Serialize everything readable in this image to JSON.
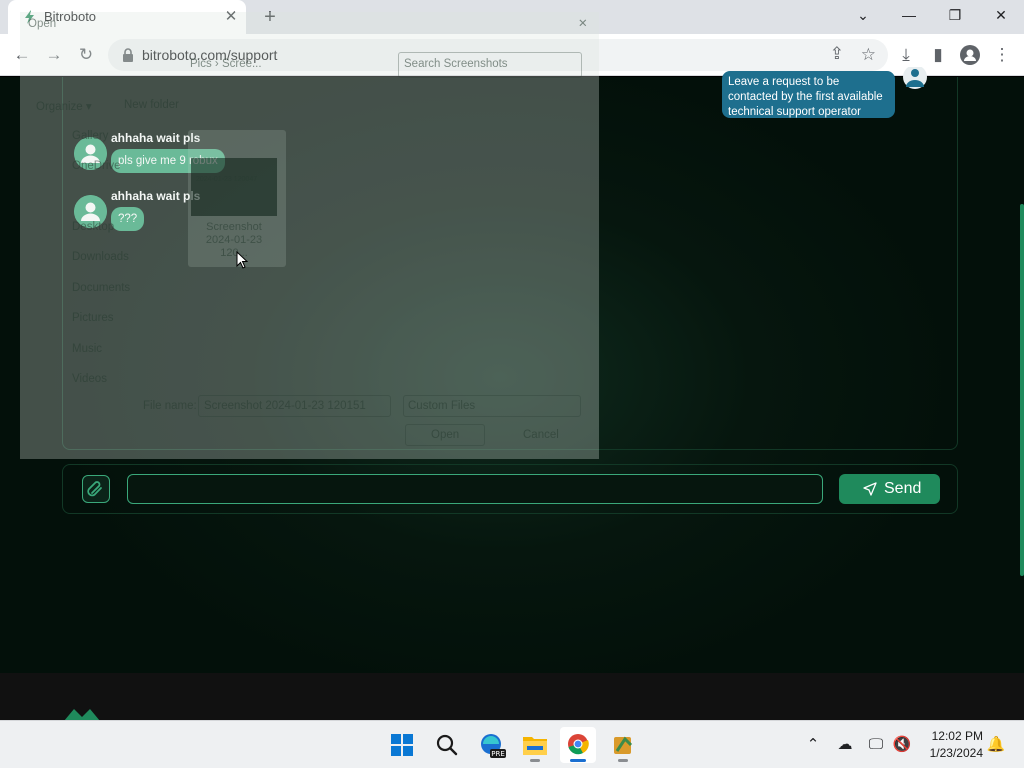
{
  "browser": {
    "tab_title": "Bitroboto",
    "url": "bitroboto.com/support",
    "icons": [
      "favicon-icon",
      "close-icon",
      "plus-icon",
      "back-icon",
      "forward-icon",
      "reload-icon",
      "lock-icon",
      "share-icon",
      "star-icon",
      "download-icon",
      "side-panel-icon",
      "profile-icon",
      "menu-icon"
    ],
    "window_controls": [
      "chevron-down-icon",
      "minimize-icon",
      "restore-icon",
      "close-icon"
    ]
  },
  "chat": {
    "operator_message": [
      "Leave a request to be",
      "contacted by the first available",
      "technical support operator"
    ],
    "messages": [
      {
        "name": "ahhaha wait pls",
        "text": "pls give me 9 robux"
      },
      {
        "name": "ahhaha wait pls",
        "text": "???"
      }
    ],
    "input_value": "",
    "send_label": "Send"
  },
  "file_dialog": {
    "title": "Open",
    "path": "Pics › Scree...",
    "search_placeholder": "Search Screenshots",
    "organize": "Organize ▾",
    "new_folder": "New folder",
    "nav": [
      "Gallery",
      "OneDrive",
      "Desktop",
      "Downloads",
      "Documents",
      "Pictures",
      "Music",
      "Videos"
    ],
    "file_name": "Screenshot 2024-01-23 120...",
    "file_timestamp": "2024-01-23 120047",
    "file_name_label": "File name:",
    "file_name_value": "Screenshot 2024-01-23 120151",
    "file_type": "Custom Files",
    "open_label": "Open",
    "cancel_label": "Cancel"
  },
  "taskbar": {
    "time": "12:02 PM",
    "date": "1/23/2024",
    "apps": [
      "windows-start-icon",
      "search-icon",
      "edge-pre-icon",
      "file-explorer-icon",
      "chrome-icon",
      "app-icon"
    ],
    "tray": [
      "chevron-up-icon",
      "onedrive-icon",
      "network-icon",
      "volume-muted-icon",
      "notification-bell-icon"
    ]
  },
  "colors": {
    "accent": "#1f8a5c",
    "bubble_green": "#3aa87a",
    "operator_bubble": "#1e6f8e",
    "page_bg": "#06160e"
  }
}
